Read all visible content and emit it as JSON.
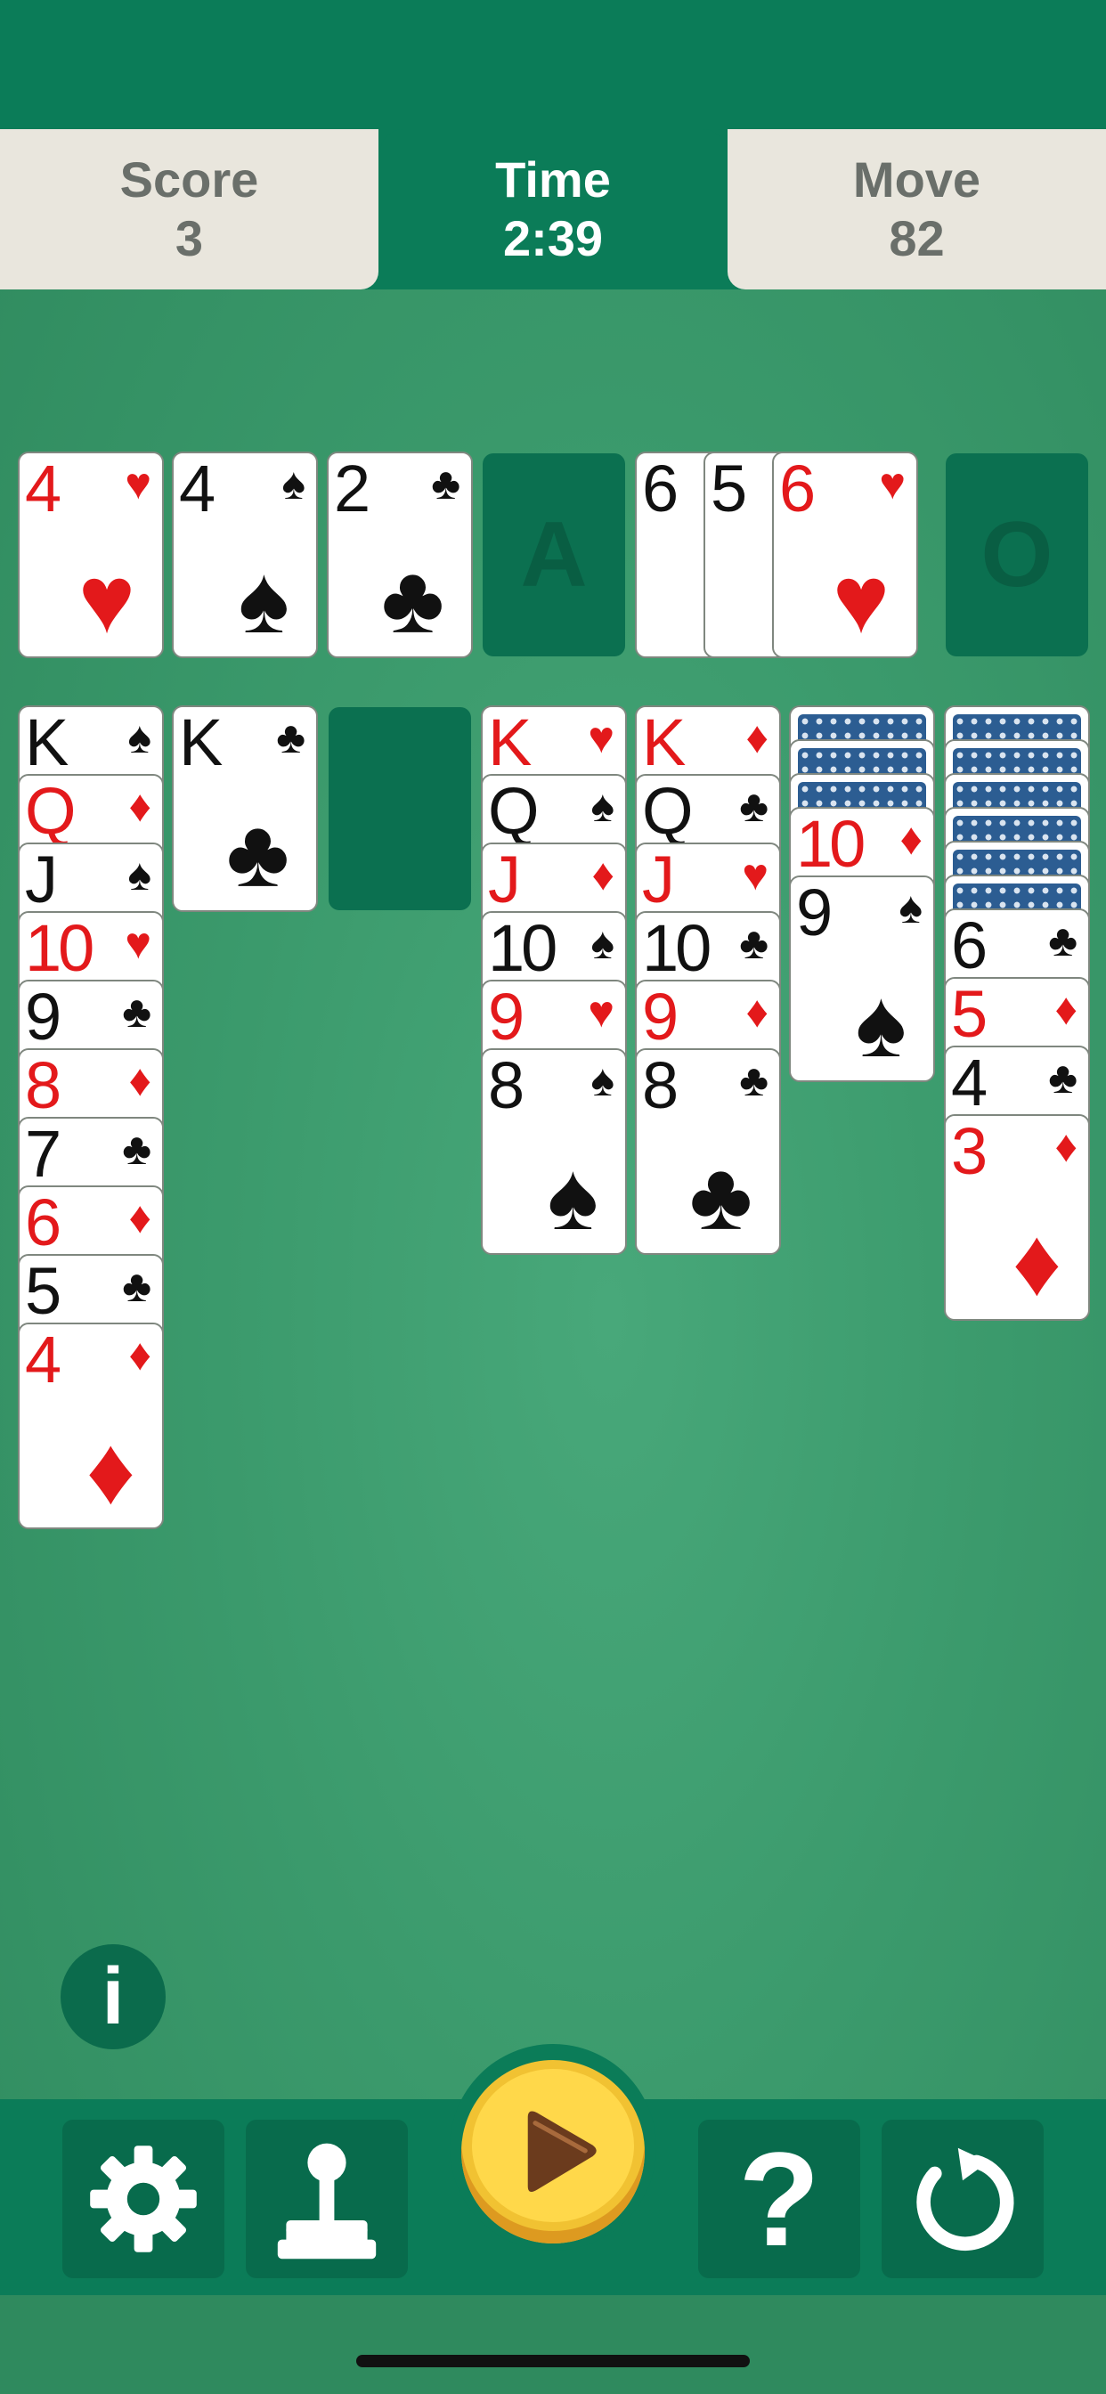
{
  "stats": {
    "score": {
      "label": "Score",
      "value": "3"
    },
    "time": {
      "label": "Time",
      "value": "2:39"
    },
    "move": {
      "label": "Move",
      "value": "82"
    }
  },
  "foundation": [
    {
      "rank": "4",
      "suit": "♥",
      "color": "red"
    },
    {
      "rank": "4",
      "suit": "♠",
      "color": "black"
    },
    {
      "rank": "2",
      "suit": "♣",
      "color": "black"
    }
  ],
  "foundation_empty": {
    "letter": "A"
  },
  "waste": [
    {
      "rank": "6",
      "suit": "♣",
      "color": "black"
    },
    {
      "rank": "5",
      "suit": "♣",
      "color": "black"
    },
    {
      "rank": "6",
      "suit": "♥",
      "color": "red"
    }
  ],
  "stock_empty": {
    "symbol": "O"
  },
  "tableau": [
    {
      "down": 0,
      "cards": [
        {
          "rank": "K",
          "suit": "♠",
          "color": "black"
        },
        {
          "rank": "Q",
          "suit": "♦",
          "color": "red"
        },
        {
          "rank": "J",
          "suit": "♠",
          "color": "black"
        },
        {
          "rank": "10",
          "suit": "♥",
          "color": "red"
        },
        {
          "rank": "9",
          "suit": "♣",
          "color": "black"
        },
        {
          "rank": "8",
          "suit": "♦",
          "color": "red"
        },
        {
          "rank": "7",
          "suit": "♣",
          "color": "black"
        },
        {
          "rank": "6",
          "suit": "♦",
          "color": "red"
        },
        {
          "rank": "5",
          "suit": "♣",
          "color": "black"
        },
        {
          "rank": "4",
          "suit": "♦",
          "color": "red"
        }
      ]
    },
    {
      "down": 0,
      "cards": [
        {
          "rank": "K",
          "suit": "♣",
          "color": "black"
        }
      ]
    },
    {
      "down": 0,
      "cards": []
    },
    {
      "down": 0,
      "cards": [
        {
          "rank": "K",
          "suit": "♥",
          "color": "red"
        },
        {
          "rank": "Q",
          "suit": "♠",
          "color": "black"
        },
        {
          "rank": "J",
          "suit": "♦",
          "color": "red"
        },
        {
          "rank": "10",
          "suit": "♠",
          "color": "black"
        },
        {
          "rank": "9",
          "suit": "♥",
          "color": "red"
        },
        {
          "rank": "8",
          "suit": "♠",
          "color": "black"
        }
      ]
    },
    {
      "down": 0,
      "cards": [
        {
          "rank": "K",
          "suit": "♦",
          "color": "red"
        },
        {
          "rank": "Q",
          "suit": "♣",
          "color": "black"
        },
        {
          "rank": "J",
          "suit": "♥",
          "color": "red"
        },
        {
          "rank": "10",
          "suit": "♣",
          "color": "black"
        },
        {
          "rank": "9",
          "suit": "♦",
          "color": "red"
        },
        {
          "rank": "8",
          "suit": "♣",
          "color": "black"
        }
      ]
    },
    {
      "down": 3,
      "cards": [
        {
          "rank": "10",
          "suit": "♦",
          "color": "red"
        },
        {
          "rank": "9",
          "suit": "♠",
          "color": "black"
        }
      ]
    },
    {
      "down": 6,
      "cards": [
        {
          "rank": "6",
          "suit": "♣",
          "color": "black"
        },
        {
          "rank": "5",
          "suit": "♦",
          "color": "red"
        },
        {
          "rank": "4",
          "suit": "♣",
          "color": "black"
        },
        {
          "rank": "3",
          "suit": "♦",
          "color": "red"
        }
      ]
    }
  ],
  "info_button": {
    "glyph": "i"
  },
  "toolbar": [
    {
      "name": "settings-button",
      "icon": "gear-icon"
    },
    {
      "name": "games-button",
      "icon": "joystick-icon"
    },
    {
      "name": "play-button",
      "icon": "play-icon"
    },
    {
      "name": "hint-button",
      "icon": "question-icon",
      "glyph": "?"
    },
    {
      "name": "restart-button",
      "icon": "restart-icon"
    }
  ],
  "colors": {
    "felt": "#3b9a6c",
    "bar": "#0b7c58",
    "button": "#086b4c",
    "play_yellow": "#ffd84a",
    "red_suit": "#e3191b",
    "card_back": "#2c5d92"
  }
}
